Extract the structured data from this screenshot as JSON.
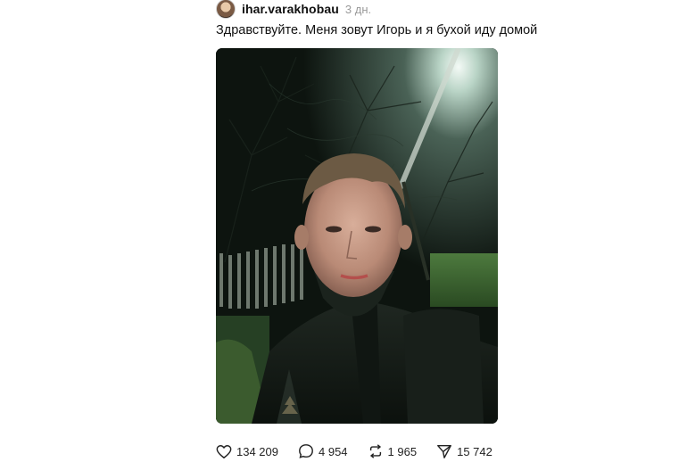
{
  "post": {
    "username": "ihar.varakhobau",
    "timestamp": "3 дн.",
    "text": "Здравствуйте. Меня зовут Игорь и я бухой иду домой"
  },
  "actions": {
    "likes": "134 209",
    "comments": "4 954",
    "reposts": "1 965",
    "shares": "15 742"
  },
  "icons": {
    "like": "heart-icon",
    "comment": "comment-bubble-icon",
    "repost": "repost-arrows-icon",
    "share": "send-icon"
  }
}
